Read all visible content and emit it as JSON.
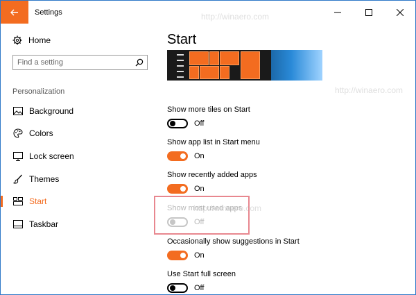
{
  "window": {
    "title": "Settings",
    "controls": [
      "minimize-icon",
      "maximize-icon",
      "close-icon"
    ]
  },
  "sidebar": {
    "home_label": "Home",
    "search_placeholder": "Find a setting",
    "section_label": "Personalization",
    "items": [
      {
        "label": "Background",
        "icon": "picture-icon",
        "active": false
      },
      {
        "label": "Colors",
        "icon": "palette-icon",
        "active": false
      },
      {
        "label": "Lock screen",
        "icon": "monitor-icon",
        "active": false
      },
      {
        "label": "Themes",
        "icon": "brush-icon",
        "active": false
      },
      {
        "label": "Start",
        "icon": "start-grid-icon",
        "active": true
      },
      {
        "label": "Taskbar",
        "icon": "taskbar-icon",
        "active": false
      }
    ]
  },
  "main": {
    "title": "Start",
    "settings": [
      {
        "label": "Show more tiles on Start",
        "state": "Off",
        "on": false,
        "disabled": false
      },
      {
        "label": "Show app list in Start menu",
        "state": "On",
        "on": true,
        "disabled": false
      },
      {
        "label": "Show recently added apps",
        "state": "On",
        "on": true,
        "disabled": false
      },
      {
        "label": "Show most used apps",
        "state": "Off",
        "on": false,
        "disabled": true
      },
      {
        "label": "Occasionally show suggestions in Start",
        "state": "On",
        "on": true,
        "disabled": false
      },
      {
        "label": "Use Start full screen",
        "state": "Off",
        "on": false,
        "disabled": false
      }
    ]
  },
  "watermark": "http://winaero.com",
  "colors": {
    "accent": "#f36c20",
    "highlight_box": "#e8878f"
  }
}
